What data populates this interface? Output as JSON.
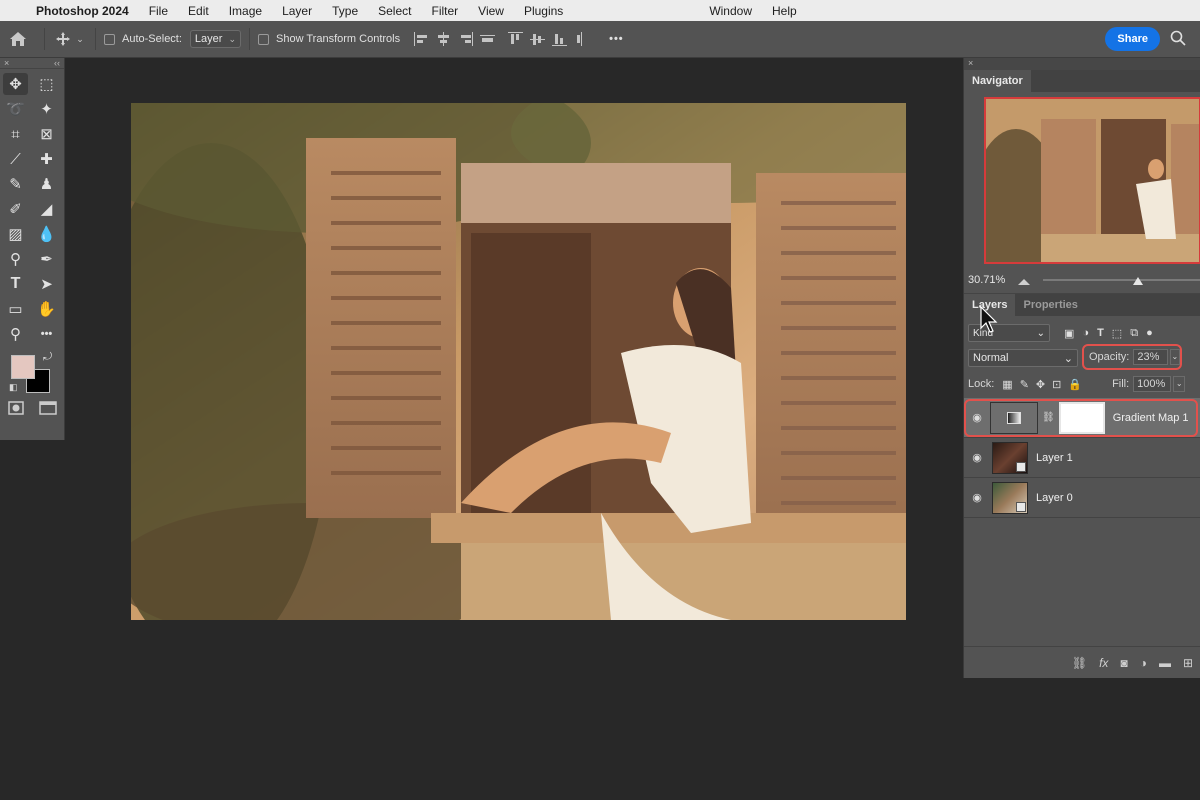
{
  "menubar": {
    "app_name": "Photoshop 2024",
    "items": [
      "File",
      "Edit",
      "Image",
      "Layer",
      "Type",
      "Select",
      "Filter",
      "View",
      "Plugins",
      "Window",
      "Help"
    ]
  },
  "options_bar": {
    "auto_select_label": "Auto-Select:",
    "auto_select_value": "Layer",
    "show_transform_label": "Show Transform Controls",
    "more": "•••",
    "share_label": "Share"
  },
  "toolbar": {
    "collapse_left": "×",
    "collapse_right": "‹‹",
    "tools": [
      {
        "icon": "move-icon",
        "glyph": "✥"
      },
      {
        "icon": "marquee-icon",
        "glyph": "⬚"
      },
      {
        "icon": "lasso-icon",
        "glyph": "➰"
      },
      {
        "icon": "magic-wand-icon",
        "glyph": "✦"
      },
      {
        "icon": "crop-icon",
        "glyph": "⌗"
      },
      {
        "icon": "frame-icon",
        "glyph": "⊠"
      },
      {
        "icon": "eyedropper-icon",
        "glyph": "⟋"
      },
      {
        "icon": "healing-brush-icon",
        "glyph": "✚"
      },
      {
        "icon": "brush-icon",
        "glyph": "✎"
      },
      {
        "icon": "stamp-icon",
        "glyph": "♟"
      },
      {
        "icon": "history-brush-icon",
        "glyph": "✐"
      },
      {
        "icon": "eraser-icon",
        "glyph": "◢"
      },
      {
        "icon": "gradient-icon",
        "glyph": "▨"
      },
      {
        "icon": "blur-icon",
        "glyph": "💧"
      },
      {
        "icon": "dodge-icon",
        "glyph": "⚲"
      },
      {
        "icon": "pen-icon",
        "glyph": "✒"
      },
      {
        "icon": "type-icon",
        "glyph": "T"
      },
      {
        "icon": "path-select-icon",
        "glyph": "➤"
      },
      {
        "icon": "rectangle-icon",
        "glyph": "▭"
      },
      {
        "icon": "hand-icon",
        "glyph": "✋"
      },
      {
        "icon": "zoom-icon",
        "glyph": "⚲"
      },
      {
        "icon": "more-tools-icon",
        "glyph": "•••"
      }
    ],
    "foreground_color": "#e4c7c0",
    "background_color": "#000000"
  },
  "navigator": {
    "tab": "Navigator",
    "zoom": "30.71%",
    "zoom_level": 0.6
  },
  "layers_panel": {
    "tabs": [
      "Layers",
      "Properties"
    ],
    "kind_filter": "Kind",
    "blend_mode": "Normal",
    "opacity_label": "Opacity:",
    "opacity_value": "23%",
    "lock_label": "Lock:",
    "fill_label": "Fill:",
    "fill_value": "100%",
    "layers": [
      {
        "name": "Gradient Map 1",
        "type": "adjustment",
        "selected": true
      },
      {
        "name": "Layer 1",
        "type": "smart",
        "selected": false
      },
      {
        "name": "Layer 0",
        "type": "smart",
        "selected": false
      }
    ]
  },
  "colors": {
    "accent_blue": "#1473e6",
    "highlight_red": "#e2514c"
  }
}
